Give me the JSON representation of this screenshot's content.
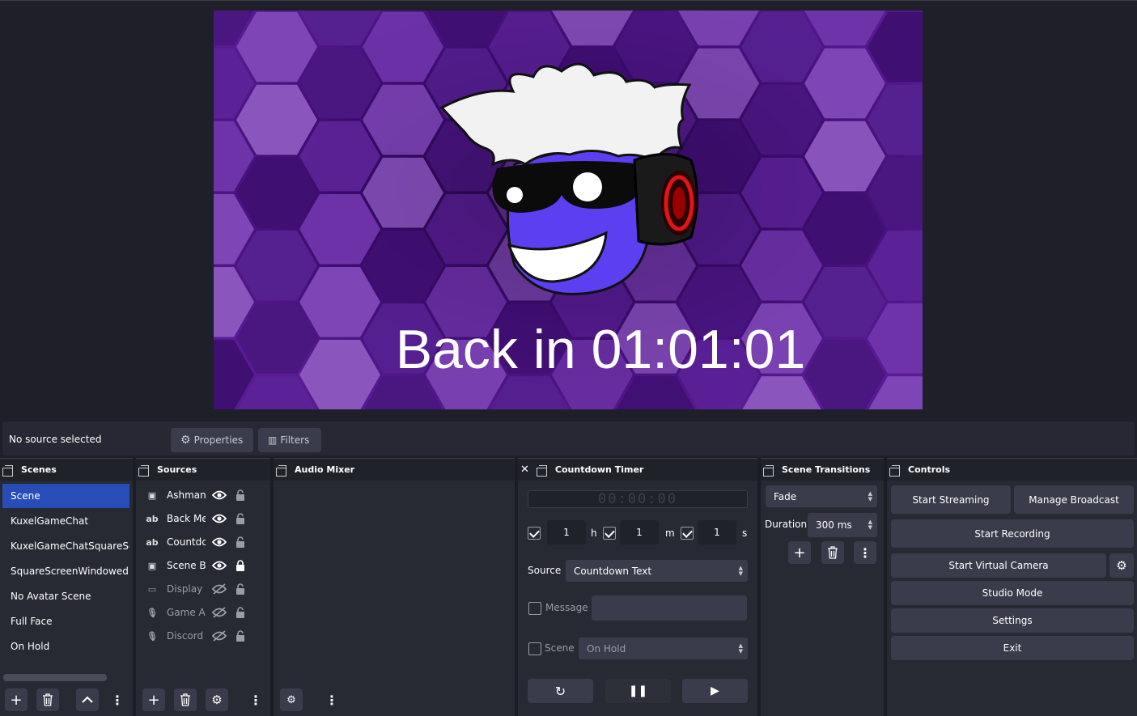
{
  "preview": {
    "overlay_text": "Back in 01:01:01"
  },
  "source_bar": {
    "status": "No source selected",
    "properties_label": "Properties",
    "filters_label": "Filters"
  },
  "scenes": {
    "title": "Scenes",
    "items": [
      {
        "label": "Scene",
        "selected": true
      },
      {
        "label": "KuxelGameChat",
        "selected": false
      },
      {
        "label": "KuxelGameChatSquareScr",
        "selected": false
      },
      {
        "label": "SquareScreenWindowed",
        "selected": false
      },
      {
        "label": "No Avatar Scene",
        "selected": false
      },
      {
        "label": "Full Face",
        "selected": false
      },
      {
        "label": "On Hold",
        "selected": false
      }
    ]
  },
  "sources": {
    "title": "Sources",
    "items": [
      {
        "label": "Ashman",
        "icon": "image-icon",
        "visible": true,
        "locked": false
      },
      {
        "label": "Back Me",
        "icon": "text-icon",
        "visible": true,
        "locked": false
      },
      {
        "label": "Countdc",
        "icon": "text-icon",
        "visible": true,
        "locked": false
      },
      {
        "label": "Scene B:",
        "icon": "image-icon",
        "visible": true,
        "locked": true
      },
      {
        "label": "Display (",
        "icon": "display-icon",
        "visible": false,
        "locked": false
      },
      {
        "label": "Game Au",
        "icon": "mic-icon",
        "visible": false,
        "locked": false
      },
      {
        "label": "Discord",
        "icon": "mic-icon",
        "visible": false,
        "locked": false
      }
    ]
  },
  "audio_mixer": {
    "title": "Audio Mixer"
  },
  "countdown": {
    "title": "Countdown Timer",
    "display": "00:00:00",
    "hours": "1",
    "minutes": "1",
    "seconds": "1",
    "h_label": "h",
    "m_label": "m",
    "s_label": "s",
    "source_label": "Source",
    "source_value": "Countdown Text",
    "message_label": "Message",
    "message_value": "",
    "scene_label": "Scene",
    "scene_value": "On Hold"
  },
  "transitions": {
    "title": "Scene Transitions",
    "transition_value": "Fade",
    "duration_label": "Duration",
    "duration_value": "300 ms"
  },
  "controls": {
    "title": "Controls",
    "start_streaming": "Start Streaming",
    "manage_broadcast": "Manage Broadcast",
    "start_recording": "Start Recording",
    "start_virtual_camera": "Start Virtual Camera",
    "studio_mode": "Studio Mode",
    "settings": "Settings",
    "exit": "Exit"
  },
  "colors": {
    "accent_selected": "#284cb8",
    "panel_bg": "#272a33",
    "button_bg": "#3a3c4b"
  }
}
